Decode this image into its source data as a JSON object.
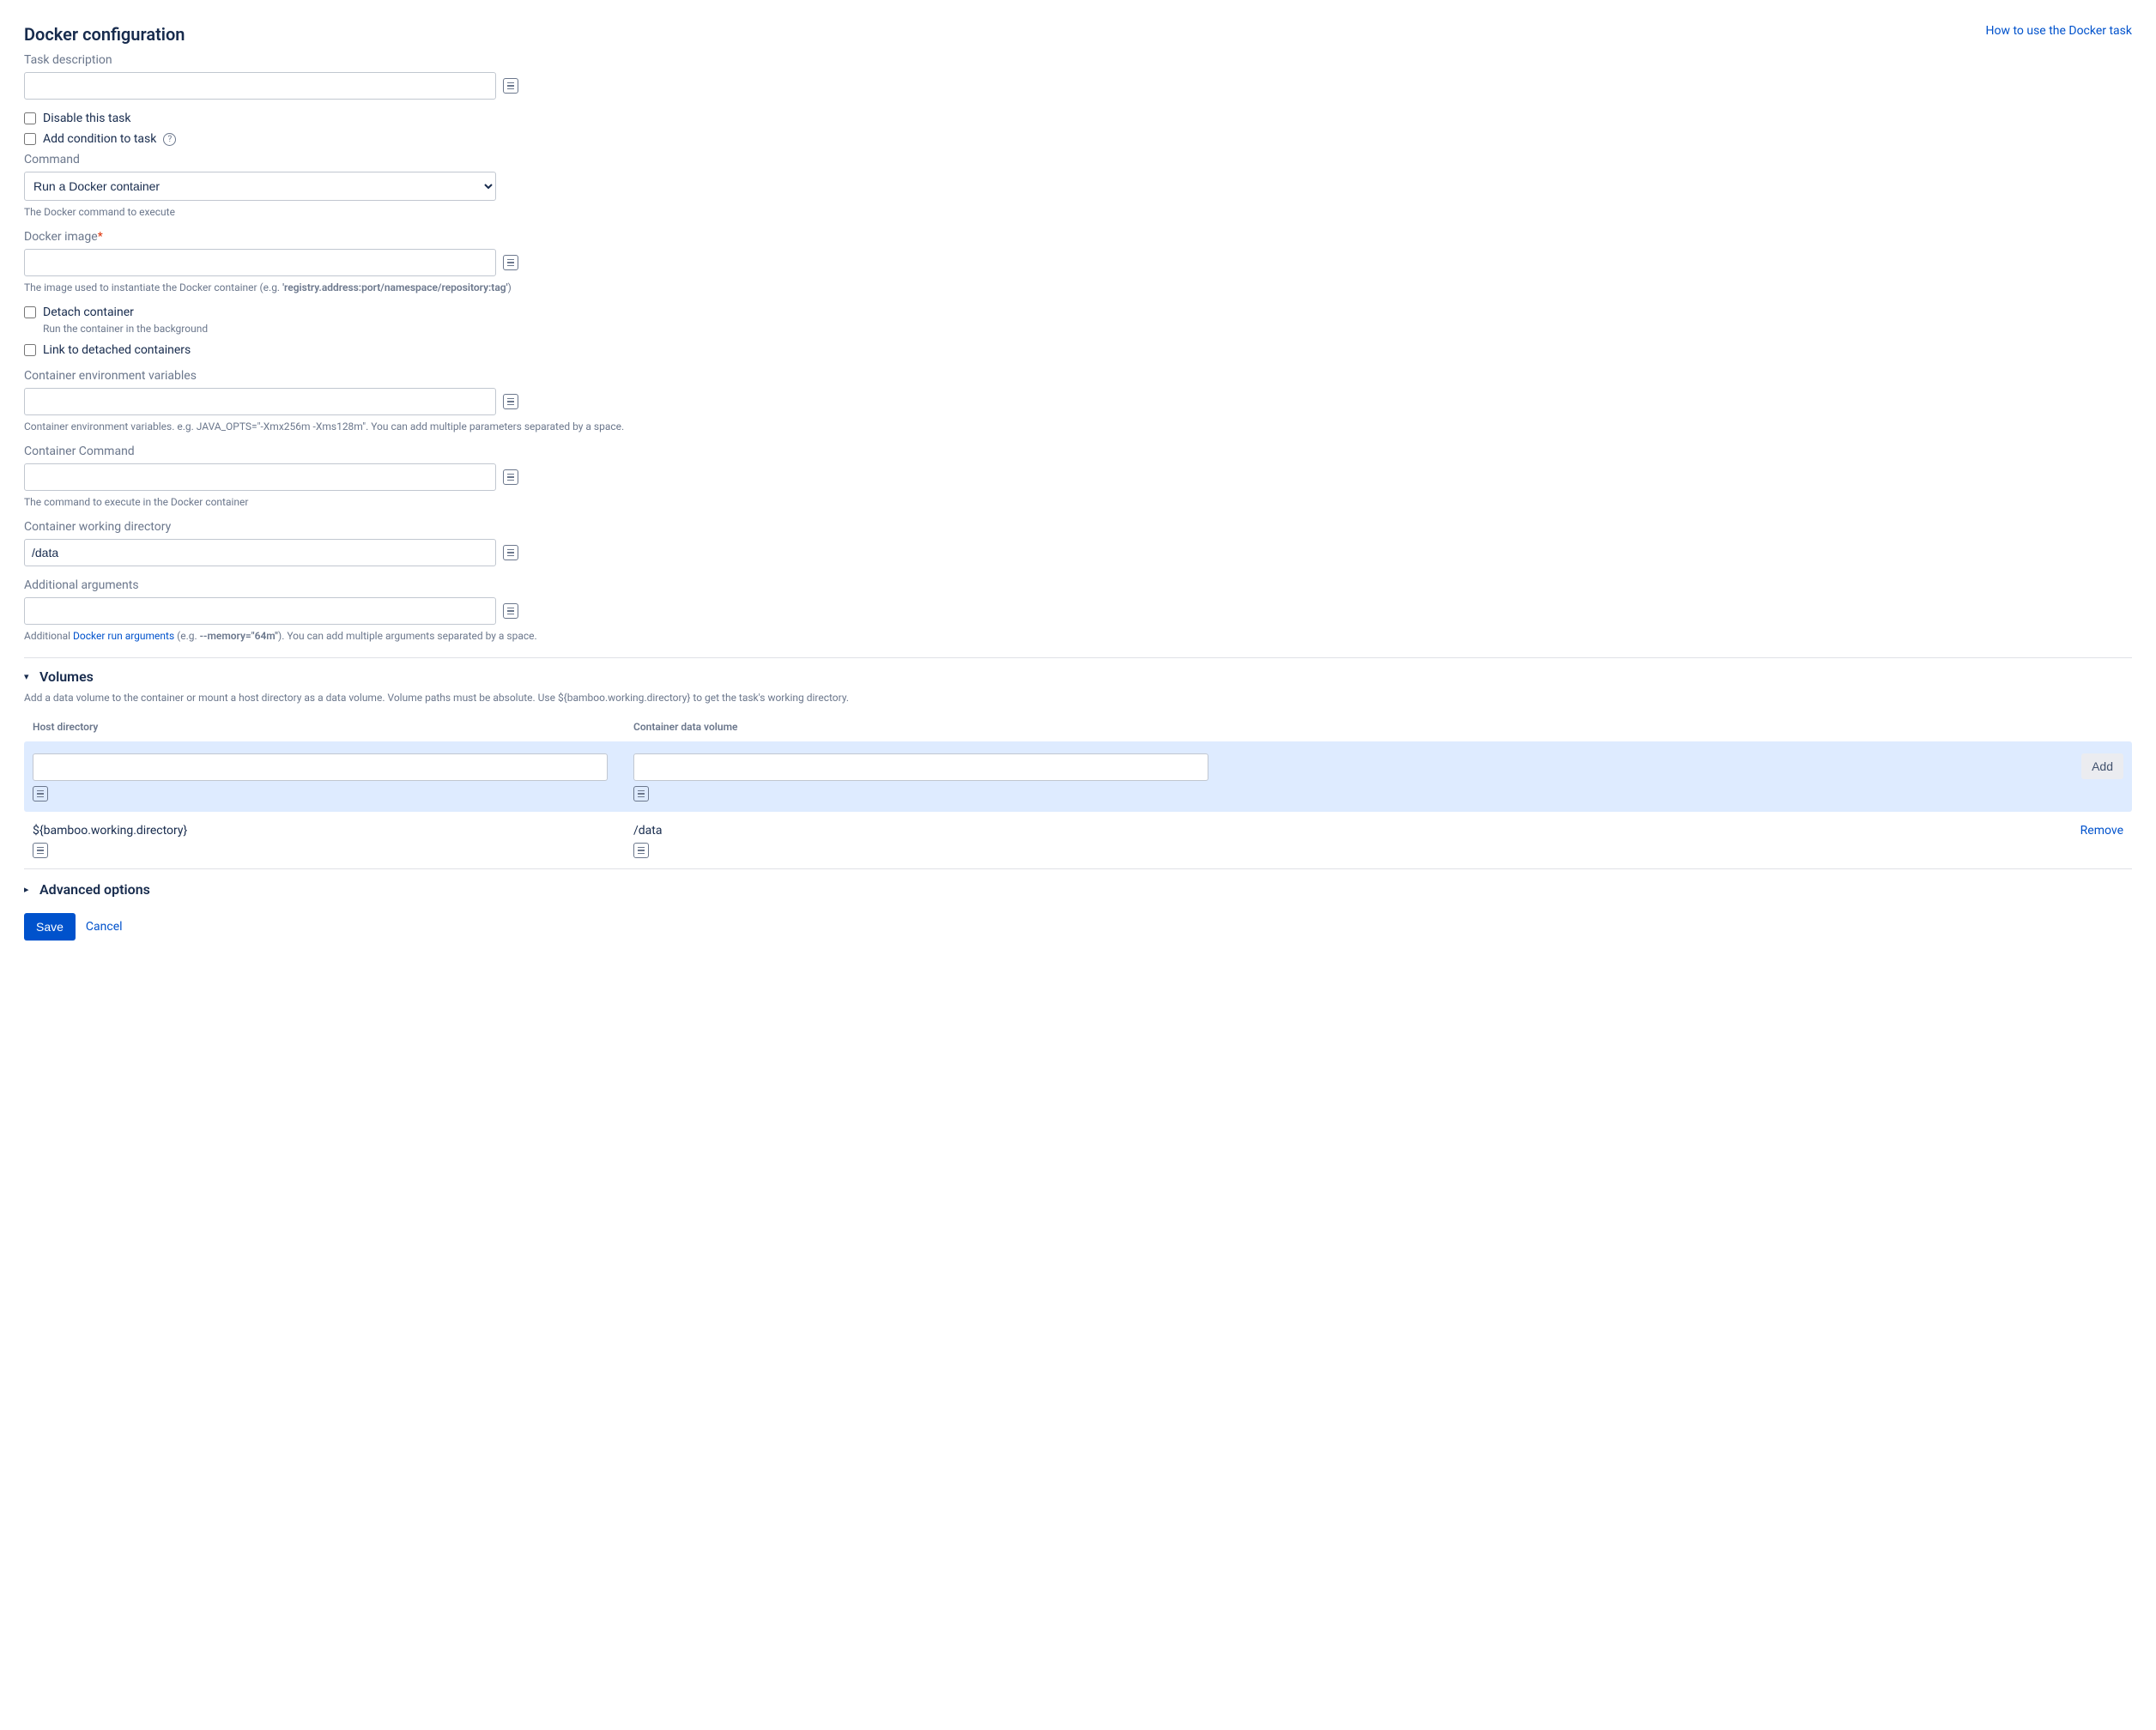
{
  "header": {
    "title": "Docker configuration",
    "help_link": "How to use the Docker task"
  },
  "task_description": {
    "label": "Task description",
    "value": ""
  },
  "disable_task": {
    "label": "Disable this task"
  },
  "add_condition": {
    "label": "Add condition to task"
  },
  "command": {
    "label": "Command",
    "selected": "Run a Docker container",
    "help": "The Docker command to execute"
  },
  "docker_image": {
    "label": "Docker image",
    "value": "",
    "help_prefix": "The image used to instantiate the Docker container (e.g. ",
    "help_strong": "'registry.address:port/namespace/repository:tag'",
    "help_suffix": ")"
  },
  "detach": {
    "label": "Detach container",
    "help": "Run the container in the background"
  },
  "link_detached": {
    "label": "Link to detached containers"
  },
  "env_vars": {
    "label": "Container environment variables",
    "value": "",
    "help": "Container environment variables. e.g. JAVA_OPTS=\"-Xmx256m -Xms128m\". You can add multiple parameters separated by a space."
  },
  "container_command": {
    "label": "Container Command",
    "value": "",
    "help": "The command to execute in the Docker container"
  },
  "working_dir": {
    "label": "Container working directory",
    "value": "/data"
  },
  "additional_args": {
    "label": "Additional arguments",
    "value": "",
    "help_prefix": "Additional ",
    "help_link": "Docker run arguments",
    "help_mid": " (e.g. ",
    "help_strong": "--memory=\"64m\"",
    "help_suffix": "). You can add multiple arguments separated by a space."
  },
  "volumes": {
    "title": "Volumes",
    "description": "Add a data volume to the container or mount a host directory as a data volume. Volume paths must be absolute. Use ${bamboo.working.directory} to get the task's working directory.",
    "col_host": "Host directory",
    "col_container": "Container data volume",
    "add_button": "Add",
    "remove_link": "Remove",
    "new_host": "",
    "new_container": "",
    "rows": [
      {
        "host": "${bamboo.working.directory}",
        "container": "/data"
      }
    ]
  },
  "advanced": {
    "title": "Advanced options"
  },
  "actions": {
    "save": "Save",
    "cancel": "Cancel"
  }
}
